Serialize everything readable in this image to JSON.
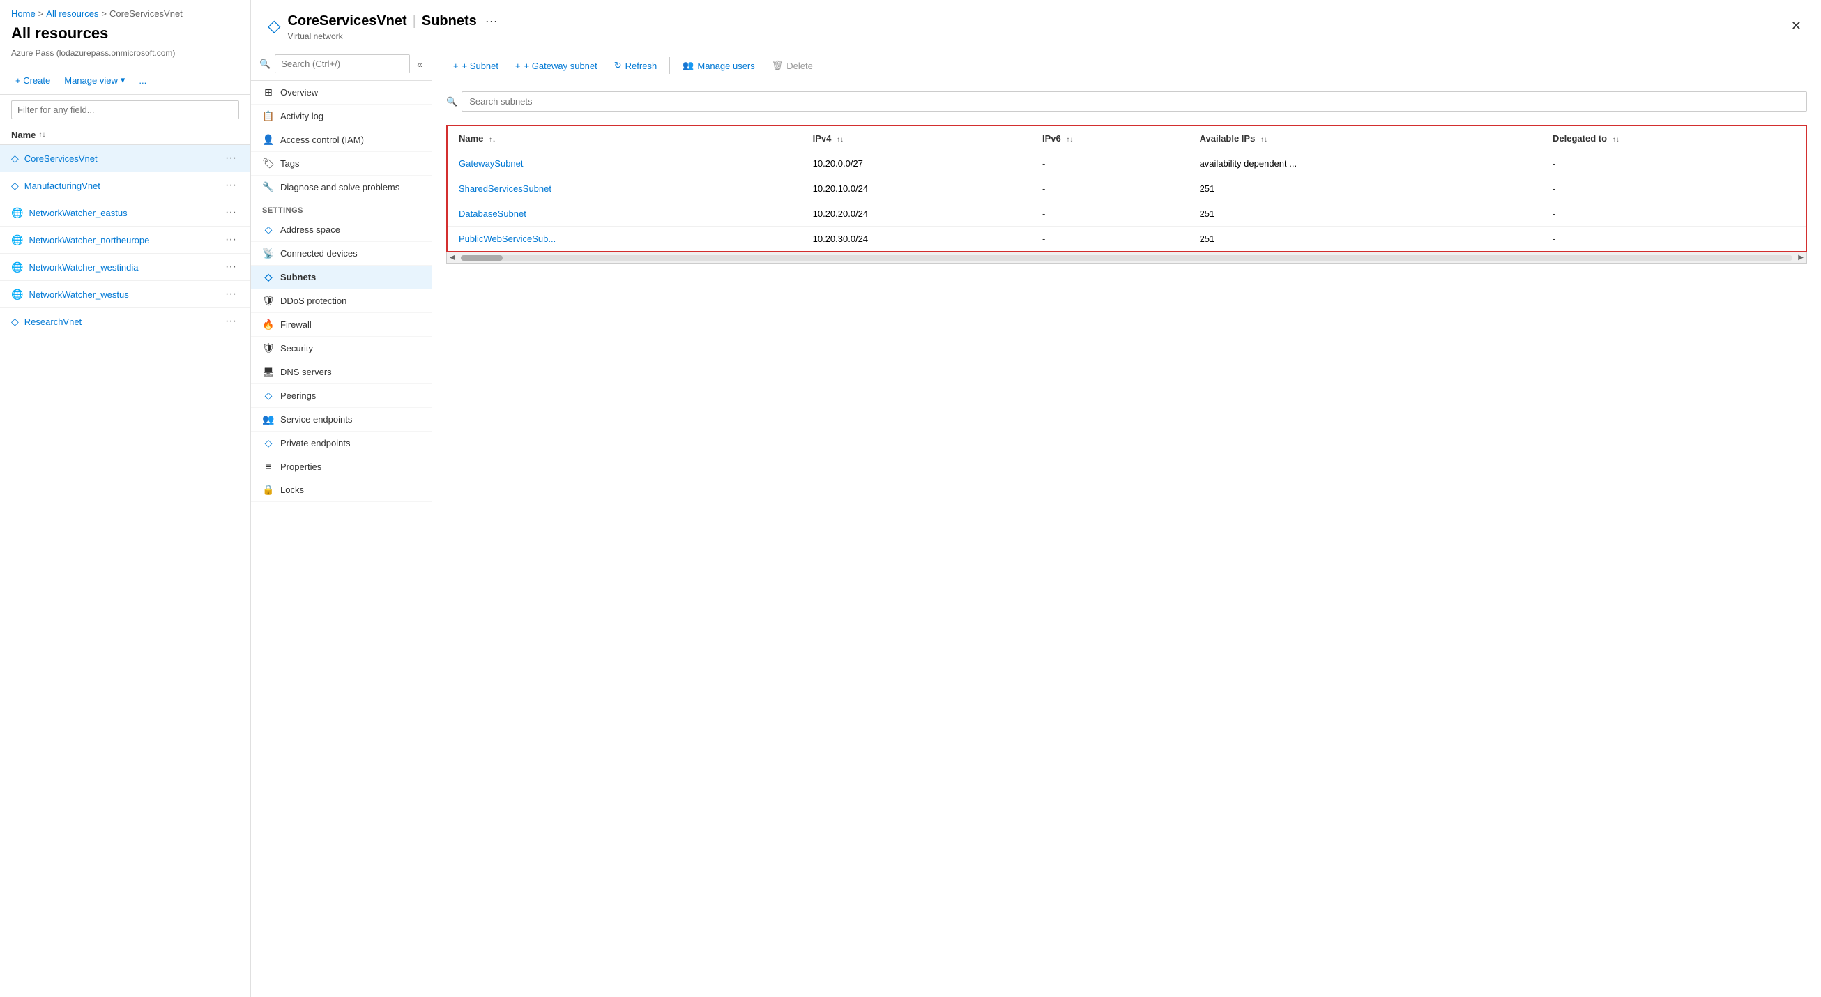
{
  "breadcrumb": {
    "home": "Home",
    "all_resources": "All resources",
    "current": "CoreServicesVnet"
  },
  "left": {
    "title": "All resources",
    "subtitle": "Azure Pass (lodazurepass.onmicrosoft.com)",
    "toolbar": {
      "create": "+ Create",
      "manage_view": "Manage view",
      "more": "..."
    },
    "filter_placeholder": "Filter for any field...",
    "col_name": "Name",
    "resources": [
      {
        "name": "CoreServicesVnet",
        "type": "vnet",
        "active": true
      },
      {
        "name": "ManufacturingVnet",
        "type": "vnet",
        "active": false
      },
      {
        "name": "NetworkWatcher_eastus",
        "type": "globe",
        "active": false
      },
      {
        "name": "NetworkWatcher_northeurope",
        "type": "globe",
        "active": false
      },
      {
        "name": "NetworkWatcher_westindia",
        "type": "globe",
        "active": false
      },
      {
        "name": "NetworkWatcher_westus",
        "type": "globe",
        "active": false
      },
      {
        "name": "ResearchVnet",
        "type": "vnet",
        "active": false
      }
    ]
  },
  "resource_panel": {
    "title": "CoreServicesVnet",
    "separator": "|",
    "section": "Subnets",
    "subtitle": "Virtual network"
  },
  "nav": {
    "search_placeholder": "Search (Ctrl+/)",
    "items": [
      {
        "id": "overview",
        "label": "Overview",
        "icon": "⊞"
      },
      {
        "id": "activity_log",
        "label": "Activity log",
        "icon": "📋"
      },
      {
        "id": "access_control",
        "label": "Access control (IAM)",
        "icon": "👤"
      },
      {
        "id": "tags",
        "label": "Tags",
        "icon": "🏷"
      },
      {
        "id": "diagnose",
        "label": "Diagnose and solve problems",
        "icon": "🔧"
      }
    ],
    "settings_header": "Settings",
    "settings_items": [
      {
        "id": "address_space",
        "label": "Address space",
        "icon": "◇"
      },
      {
        "id": "connected_devices",
        "label": "Connected devices",
        "icon": "📡"
      },
      {
        "id": "subnets",
        "label": "Subnets",
        "icon": "◇",
        "active": true
      },
      {
        "id": "ddos_protection",
        "label": "DDoS protection",
        "icon": "🛡"
      },
      {
        "id": "firewall",
        "label": "Firewall",
        "icon": "🔥"
      },
      {
        "id": "security",
        "label": "Security",
        "icon": "🛡"
      },
      {
        "id": "dns_servers",
        "label": "DNS servers",
        "icon": "🖥"
      },
      {
        "id": "peerings",
        "label": "Peerings",
        "icon": "◇"
      },
      {
        "id": "service_endpoints",
        "label": "Service endpoints",
        "icon": "👥"
      },
      {
        "id": "private_endpoints",
        "label": "Private endpoints",
        "icon": "◇"
      },
      {
        "id": "properties",
        "label": "Properties",
        "icon": "≡"
      },
      {
        "id": "locks",
        "label": "Locks",
        "icon": "🔒"
      }
    ]
  },
  "toolbar": {
    "add_subnet": "+ Subnet",
    "gateway_subnet": "+ Gateway subnet",
    "refresh": "Refresh",
    "manage_users": "Manage users",
    "delete": "Delete"
  },
  "search_subnets_placeholder": "Search subnets",
  "table": {
    "columns": [
      {
        "id": "name",
        "label": "Name"
      },
      {
        "id": "ipv4",
        "label": "IPv4"
      },
      {
        "id": "ipv6",
        "label": "IPv6"
      },
      {
        "id": "available_ips",
        "label": "Available IPs"
      },
      {
        "id": "delegated_to",
        "label": "Delegated to"
      }
    ],
    "rows": [
      {
        "name": "GatewaySubnet",
        "ipv4": "10.20.0.0/27",
        "ipv6": "-",
        "available_ips": "availability dependent ...",
        "delegated_to": "-"
      },
      {
        "name": "SharedServicesSubnet",
        "ipv4": "10.20.10.0/24",
        "ipv6": "-",
        "available_ips": "251",
        "delegated_to": "-"
      },
      {
        "name": "DatabaseSubnet",
        "ipv4": "10.20.20.0/24",
        "ipv6": "-",
        "available_ips": "251",
        "delegated_to": "-"
      },
      {
        "name": "PublicWebServiceSub...",
        "ipv4": "10.20.30.0/24",
        "ipv6": "-",
        "available_ips": "251",
        "delegated_to": "-"
      }
    ]
  },
  "colors": {
    "accent": "#0078d4",
    "border_highlight": "#d32f2f"
  }
}
